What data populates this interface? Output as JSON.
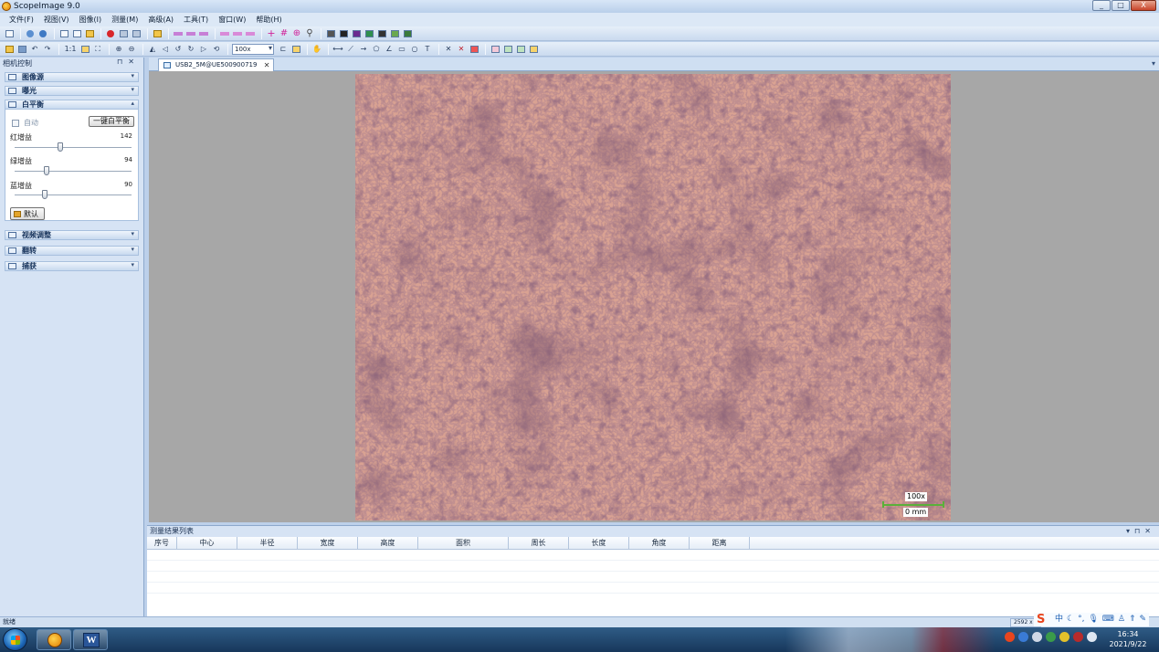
{
  "window": {
    "title": "ScopeImage 9.0",
    "buttons": [
      "_",
      "□",
      "X"
    ]
  },
  "menu": [
    "文件(F)",
    "视图(V)",
    "图像(I)",
    "测量(M)",
    "高级(A)",
    "工具(T)",
    "窗口(W)",
    "帮助(H)"
  ],
  "toolbar": {
    "ratio_label": "1:1",
    "zoom_value": "100x"
  },
  "camera_panel": {
    "title": "相机控制",
    "sections": {
      "image_source": "图像源",
      "exposure": "曝光",
      "white_balance": "白平衡",
      "video_adjust": "视频调整",
      "flip": "翻转",
      "capture": "捕获"
    },
    "white_balance": {
      "auto_label": "自动",
      "auto_checked": false,
      "one_click_button": "一键白平衡",
      "red_gain_label": "红增益",
      "red_gain_value": "142",
      "red_gain_fraction": 0.39,
      "green_gain_label": "绿增益",
      "green_gain_value": "94",
      "green_gain_fraction": 0.27,
      "blue_gain_label": "蓝增益",
      "blue_gain_value": "90",
      "blue_gain_fraction": 0.26,
      "default_button": "默认"
    }
  },
  "document_tab": {
    "label": "USB2_5M@UE500900719"
  },
  "image": {
    "magnification_label": "100x",
    "scale_label": "0 mm",
    "scale_color": "#5ab03a"
  },
  "results": {
    "title": "测量结果列表",
    "columns": [
      "序号",
      "中心",
      "半径",
      "宽度",
      "高度",
      "面积",
      "周长",
      "长度",
      "角度",
      "距离"
    ]
  },
  "status": {
    "text": "就绪",
    "resolution_partial": "2592 x 1"
  },
  "taskbar": {
    "time": "16:34",
    "date": "2021/9/22",
    "ime_label": "中"
  },
  "colors": {
    "accent": "#bcd0ea",
    "panel": "#d6e3f4",
    "viewer_bg": "#a7a7a7"
  }
}
